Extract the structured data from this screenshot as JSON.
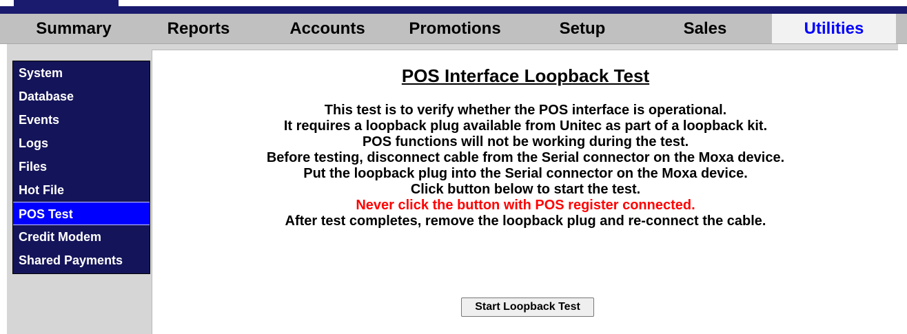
{
  "colors": {
    "header_navy": "#1a1a6e",
    "tab_bar": "#c0c0c0",
    "active_tab_text": "#0000ff",
    "sidebar_bg": "#14145a",
    "sidebar_active": "#0000ff",
    "warning_text": "#ff0000"
  },
  "tabs": [
    {
      "label": "Summary",
      "active": false
    },
    {
      "label": "Reports",
      "active": false
    },
    {
      "label": "Accounts",
      "active": false
    },
    {
      "label": "Promotions",
      "active": false
    },
    {
      "label": "Setup",
      "active": false
    },
    {
      "label": "Sales",
      "active": false
    },
    {
      "label": "Utilities",
      "active": true
    }
  ],
  "sidebar": {
    "items": [
      {
        "label": "System",
        "active": false
      },
      {
        "label": "Database",
        "active": false
      },
      {
        "label": "Events",
        "active": false
      },
      {
        "label": "Logs",
        "active": false
      },
      {
        "label": "Files",
        "active": false
      },
      {
        "label": "Hot File",
        "active": false
      },
      {
        "label": "POS Test",
        "active": true
      },
      {
        "label": "Credit Modem",
        "active": false
      },
      {
        "label": "Shared Payments",
        "active": false
      }
    ]
  },
  "main": {
    "title": "POS Interface Loopback Test",
    "lines": [
      "This test is to verify whether the POS interface is operational.",
      "It requires a loopback plug available from Unitec as part of a loopback kit.",
      "POS functions will not be working during the test.",
      "Before testing, disconnect cable from the Serial connector on the Moxa device.",
      "Put the loopback plug into the Serial connector on the Moxa device.",
      "Click button below to start the test.",
      "Never click the button with POS register connected.",
      "After test completes, remove the loopback plug and re-connect the cable."
    ],
    "button_label": "Start Loopback Test"
  }
}
